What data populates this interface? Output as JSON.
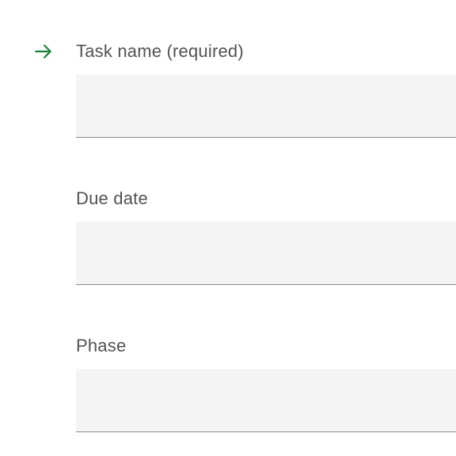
{
  "form": {
    "fields": [
      {
        "label": "Task name (required)",
        "value": "",
        "has_arrow": true
      },
      {
        "label": "Due date",
        "value": "",
        "has_arrow": false
      },
      {
        "label": "Phase",
        "value": "",
        "has_arrow": false
      }
    ]
  },
  "colors": {
    "arrow": "#198038",
    "label": "#525252",
    "input_bg": "#f4f4f4",
    "input_border": "#8d8d8d"
  }
}
